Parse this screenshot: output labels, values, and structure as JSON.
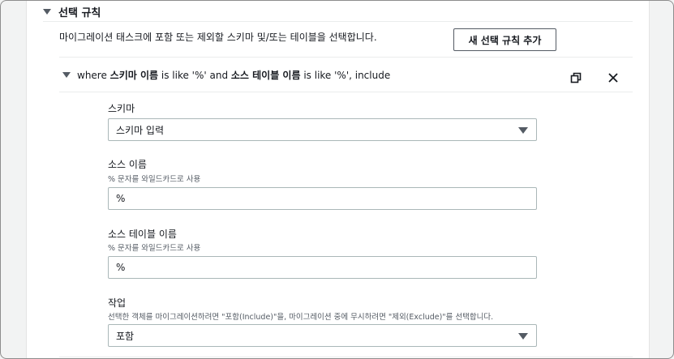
{
  "section": {
    "title": "선택 규칙",
    "description": "마이그레이션 태스크에 포함 또는 제외할 스키마 및/또는 테이블을 선택합니다.",
    "add_button": "새 선택 규칙 추가"
  },
  "rule": {
    "title_parts": [
      "where ",
      "스키마 이름",
      " is like '%' and ",
      "소스 테이블 이름",
      " is like '%', include"
    ],
    "copy_icon": "copy-icon",
    "close_icon": "close-icon"
  },
  "fields": {
    "schema": {
      "label": "스키마",
      "selected": "스키마 입력"
    },
    "source_name": {
      "label": "소스 이름",
      "hint": "% 문자를 와일드카드로 사용",
      "value": "%"
    },
    "source_table_name": {
      "label": "소스 테이블 이름",
      "hint": "% 문자를 와일드카드로 사용",
      "value": "%"
    },
    "action": {
      "label": "작업",
      "hint": "선택한 객체를 마이그레이션하려면 \"포함(Include)\"을, 마이그레이션 중에 무시하려면 \"제외(Exclude)\"를 선택합니다.",
      "selected": "포함"
    }
  }
}
